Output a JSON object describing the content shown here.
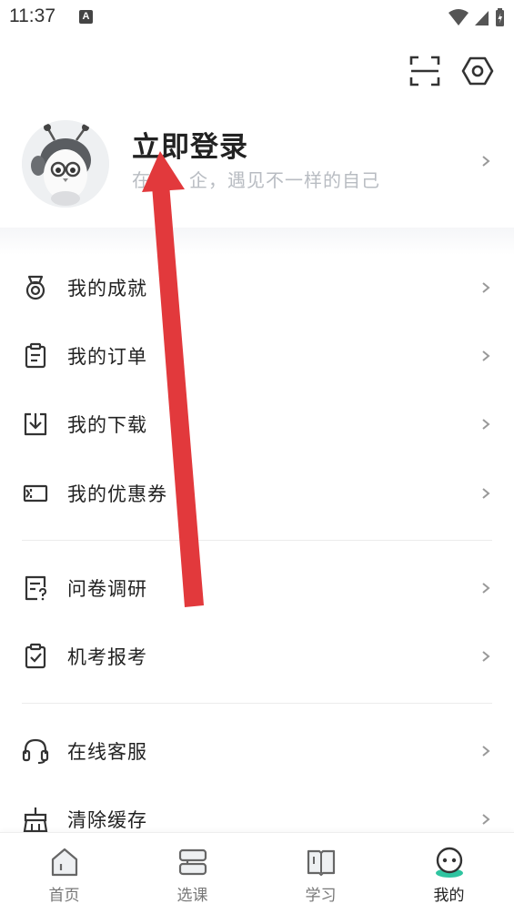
{
  "status_bar": {
    "time": "11:37",
    "notification_badge": "A",
    "icons": [
      "wifi-icon",
      "signal-icon",
      "battery-charging-icon"
    ]
  },
  "header": {
    "icons": [
      "scan-icon",
      "settings-icon"
    ]
  },
  "profile": {
    "title": "立即登录",
    "subtitle_visible_start": "在",
    "subtitle_visible_end": "企，遇见不一样的自己",
    "avatar_icon": "bee-mascot-avatar"
  },
  "menu_groups": [
    [
      {
        "label": "我的成就",
        "icon": "medal-icon"
      },
      {
        "label": "我的订单",
        "icon": "clipboard-icon"
      },
      {
        "label": "我的下载",
        "icon": "download-icon"
      },
      {
        "label": "我的优惠券",
        "icon": "coupon-icon"
      }
    ],
    [
      {
        "label": "问卷调研",
        "icon": "survey-icon"
      },
      {
        "label": "机考报考",
        "icon": "exam-check-icon"
      }
    ],
    [
      {
        "label": "在线客服",
        "icon": "headset-icon"
      },
      {
        "label": "清除缓存",
        "icon": "broom-icon"
      }
    ]
  ],
  "tabs": [
    {
      "label": "首页",
      "icon": "home-icon",
      "active": false
    },
    {
      "label": "选课",
      "icon": "courses-icon",
      "active": false
    },
    {
      "label": "学习",
      "icon": "book-icon",
      "active": false
    },
    {
      "label": "我的",
      "icon": "profile-icon",
      "active": true
    }
  ],
  "colors": {
    "accent": "#2fc4a0",
    "annotation_arrow": "#e2393c",
    "subtitle": "#b8bcc2"
  }
}
